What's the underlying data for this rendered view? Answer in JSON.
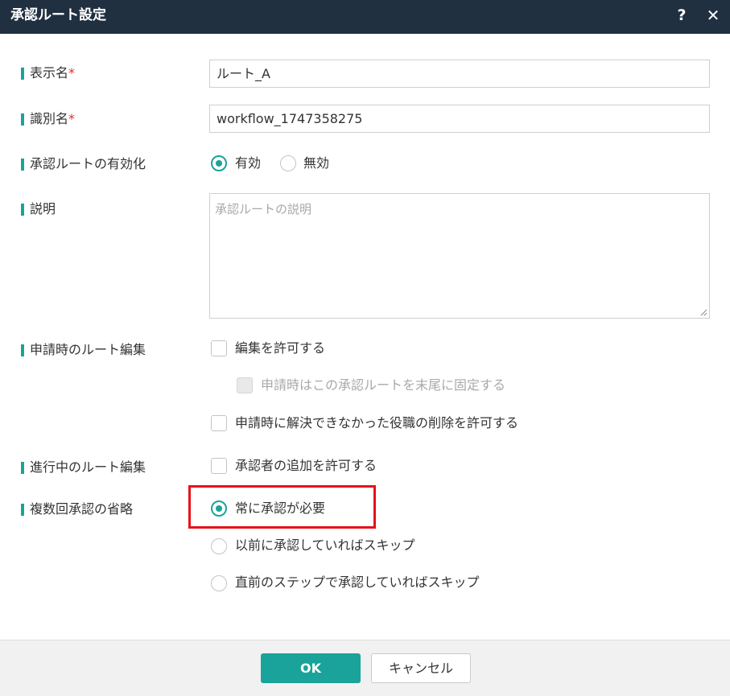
{
  "dialog": {
    "title": "承認ルート設定",
    "help_icon_glyph": "?",
    "close_icon_glyph": "✕"
  },
  "fields": {
    "display_name": {
      "label": "表示名",
      "required_mark": "*",
      "value": "ルート_A"
    },
    "identifier": {
      "label": "識別名",
      "required_mark": "*",
      "value": "workflow_1747358275"
    },
    "enable_route": {
      "label": "承認ルートの有効化",
      "options": [
        {
          "label": "有効",
          "selected": true
        },
        {
          "label": "無効",
          "selected": false
        }
      ]
    },
    "description": {
      "label": "説明",
      "placeholder": "承認ルートの説明",
      "value": ""
    },
    "edit_on_apply": {
      "label": "申請時のルート編集",
      "options": [
        {
          "label": "編集を許可する",
          "checked": false,
          "disabled": false
        },
        {
          "label": "申請時はこの承認ルートを末尾に固定する",
          "checked": false,
          "disabled": true
        },
        {
          "label": "申請時に解決できなかった役職の削除を許可する",
          "checked": false,
          "disabled": false
        }
      ]
    },
    "edit_in_progress": {
      "label": "進行中のルート編集",
      "options": [
        {
          "label": "承認者の追加を許可する",
          "checked": false
        }
      ]
    },
    "skip_multiple": {
      "label": "複数回承認の省略",
      "options": [
        {
          "label": "常に承認が必要",
          "selected": true
        },
        {
          "label": "以前に承認していればスキップ",
          "selected": false
        },
        {
          "label": "直前のステップで承認していればスキップ",
          "selected": false
        }
      ]
    }
  },
  "footer": {
    "ok_label": "OK",
    "cancel_label": "キャンセル"
  },
  "colors": {
    "titlebar": "#203040",
    "accent": "#1aa39a",
    "required": "#e0302c",
    "highlight_box": "#e8111a"
  },
  "icons": {
    "help": "help-icon",
    "close": "close-icon",
    "resize": "resize-grip-icon"
  }
}
